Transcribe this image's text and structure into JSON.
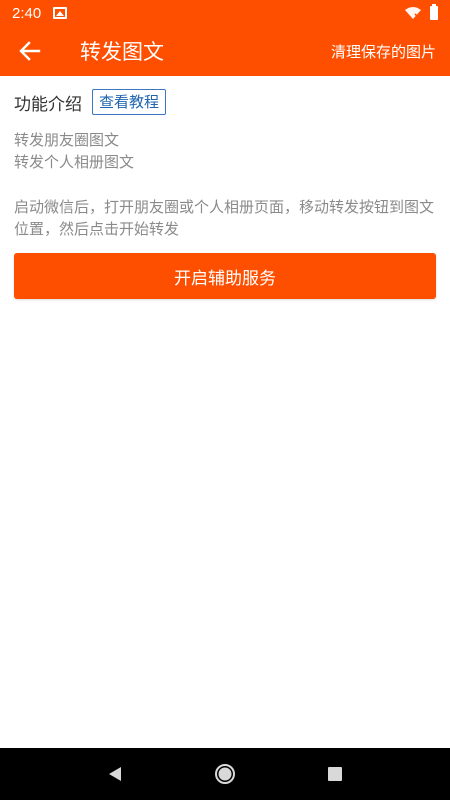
{
  "status_bar": {
    "time": "2:40",
    "photo_icon": "image-icon",
    "wifi_icon": "wifi-off-icon",
    "battery_icon": "battery-icon"
  },
  "app_bar": {
    "back_icon": "arrow-left-icon",
    "title": "转发图文",
    "action_label": "清理保存的图片"
  },
  "intro": {
    "label": "功能介绍",
    "tutorial_label": "查看教程"
  },
  "features": [
    "转发朋友圈图文",
    "转发个人相册图文"
  ],
  "instructions": "启动微信后，打开朋友圈或个人相册页面，移动转发按钮到图文位置，然后点击开始转发",
  "start_button_label": "开启辅助服务",
  "nav_bar": {
    "back_icon": "triangle-back-icon",
    "home_icon": "circle-home-icon",
    "recents_icon": "square-recents-icon"
  },
  "colors": {
    "accent": "#fe4f00",
    "text_primary": "#333333",
    "text_secondary": "#8a8a8a",
    "link": "#1e64b0"
  }
}
